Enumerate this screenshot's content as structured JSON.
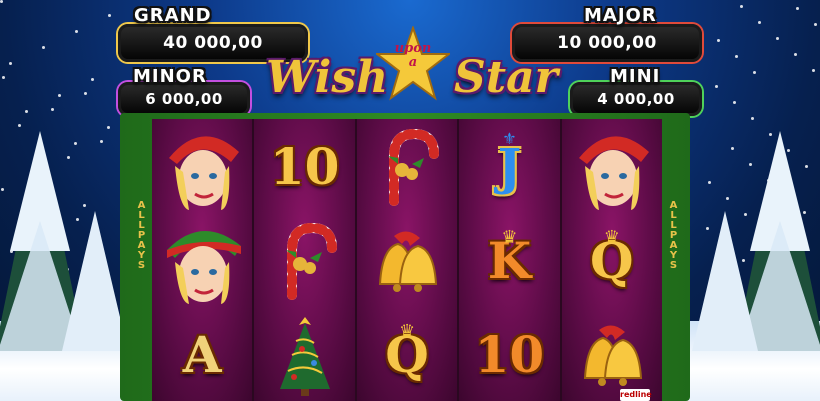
{
  "jackpots": {
    "grand": {
      "label": "GRAND",
      "value": "40 000,00"
    },
    "major": {
      "label": "MAJOR",
      "value": "10 000,00"
    },
    "minor": {
      "label": "MINOR",
      "value": "6 000,00"
    },
    "mini": {
      "label": "MINI",
      "value": "4 000,00"
    }
  },
  "logo": {
    "wish": "Wish",
    "upon": "upon",
    "a": "a",
    "star": "Star"
  },
  "side_label": "ALLPAYS",
  "brand": "redline",
  "reels": [
    [
      {
        "symbol": "elf-girl-icon"
      },
      {
        "symbol": "elf-girl-icon"
      },
      {
        "text": "A",
        "symbol": "ace-icon"
      }
    ],
    [
      {
        "text": "10",
        "symbol": "ten-icon"
      },
      {
        "symbol": "candy-cane-icon"
      },
      {
        "symbol": "christmas-tree-icon"
      }
    ],
    [
      {
        "symbol": "candy-cane-icon"
      },
      {
        "symbol": "bells-icon"
      },
      {
        "text": "Q",
        "symbol": "queen-icon"
      }
    ],
    [
      {
        "text": "J",
        "symbol": "jack-icon"
      },
      {
        "text": "K",
        "symbol": "king-icon"
      },
      {
        "text": "10",
        "symbol": "ten-icon"
      }
    ],
    [
      {
        "symbol": "elf-girl-icon"
      },
      {
        "text": "Q",
        "symbol": "queen-icon"
      },
      {
        "symbol": "bells-icon"
      }
    ]
  ],
  "colors": {
    "reel_bg": "#5e0c48",
    "frame": "#2f8b23",
    "gold": "#f6c64a"
  }
}
